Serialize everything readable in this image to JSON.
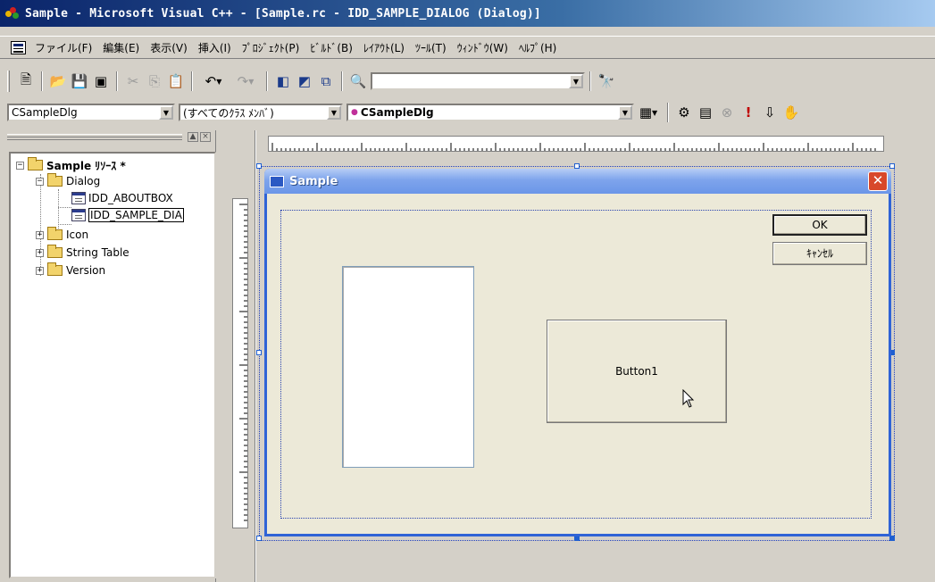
{
  "window": {
    "title": "Sample - Microsoft Visual C++ - [Sample.rc - IDD_SAMPLE_DIALOG (Dialog)]",
    "icon": "visual-cpp-icon"
  },
  "menubar": {
    "items": [
      "ファイル(F)",
      "編集(E)",
      "表示(V)",
      "挿入(I)",
      "ﾌﾟﾛｼﾞｪｸﾄ(P)",
      "ﾋﾞﾙﾄﾞ(B)",
      "ﾚｲｱｳﾄ(L)",
      "ﾂｰﾙ(T)",
      "ｳｨﾝﾄﾞｳ(W)",
      "ﾍﾙﾌﾟ(H)"
    ]
  },
  "toolbar": {
    "find_combo_value": ""
  },
  "wizardbar": {
    "class_combo": "CSampleDlg",
    "filter_combo": "(すべてのｸﾗｽ ﾒﾝﾊﾞ)",
    "member_combo": "CSampleDlg"
  },
  "tree": {
    "root": "Sample ﾘｿｰｽ *",
    "nodes": [
      {
        "label": "Dialog"
      },
      {
        "label": "IDD_ABOUTBOX"
      },
      {
        "label": "IDD_SAMPLE_DIA"
      },
      {
        "label": "Icon"
      },
      {
        "label": "String Table"
      },
      {
        "label": "Version"
      }
    ]
  },
  "dialog": {
    "title": "Sample",
    "ok_label": "OK",
    "cancel_label": "ｷｬﾝｾﾙ",
    "button1_label": "Button1"
  },
  "colors": {
    "title_bar": "#0a246a",
    "dialog_title": "#6b96e8",
    "close_button": "#d8482a",
    "selection_handles": "#1f5fd0"
  }
}
